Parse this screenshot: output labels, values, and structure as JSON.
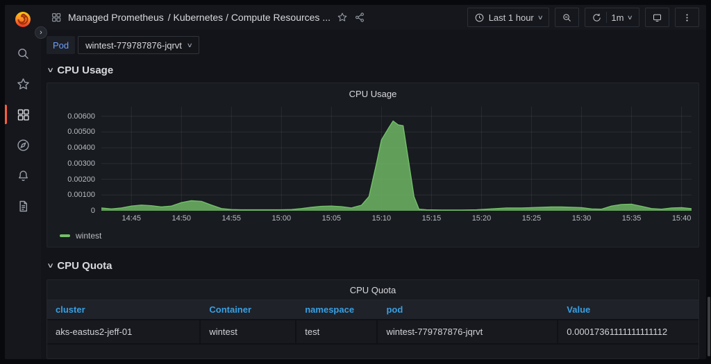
{
  "topnav": {
    "breadcrumb_root": "Managed Prometheus",
    "breadcrumb_path": "/ Kubernetes / Compute Resources ...",
    "time_range": "Last 1 hour",
    "refresh_interval": "1m"
  },
  "sidebar": {
    "icons": [
      "grafana-logo",
      "expand-sidebar",
      "search",
      "starred",
      "dashboards (active)",
      "explore",
      "alerting",
      "docs"
    ]
  },
  "filters": {
    "pod_label": "Pod",
    "pod_value": "wintest-779787876-jqrvt"
  },
  "sections": {
    "cpu_usage": "CPU Usage",
    "cpu_quota": "CPU Quota"
  },
  "chart_data": {
    "type": "area",
    "title": "CPU Usage",
    "xlabel": "",
    "ylabel": "",
    "grid": true,
    "legend_position": "bottom-left",
    "x_range": [
      "14:42:00",
      "15:41:00"
    ],
    "ylim": [
      0,
      0.0066
    ],
    "x_ticks": [
      "14:45",
      "14:50",
      "14:55",
      "15:00",
      "15:05",
      "15:10",
      "15:15",
      "15:20",
      "15:25",
      "15:30",
      "15:35",
      "15:40"
    ],
    "y_ticks": [
      {
        "v": 0,
        "label": "0"
      },
      {
        "v": 0.001,
        "label": "0.00100"
      },
      {
        "v": 0.002,
        "label": "0.00200"
      },
      {
        "v": 0.003,
        "label": "0.00300"
      },
      {
        "v": 0.004,
        "label": "0.00400"
      },
      {
        "v": 0.005,
        "label": "0.00500"
      },
      {
        "v": 0.006,
        "label": "0.00600"
      }
    ],
    "series": [
      {
        "name": "wintest",
        "color": "#73BF69",
        "points": [
          [
            "14:42:00",
            0.00018
          ],
          [
            "14:43:00",
            0.00012
          ],
          [
            "14:44:00",
            0.00018
          ],
          [
            "14:45:00",
            0.0003
          ],
          [
            "14:46:00",
            0.00036
          ],
          [
            "14:47:00",
            0.00032
          ],
          [
            "14:48:00",
            0.00024
          ],
          [
            "14:49:00",
            0.0003
          ],
          [
            "14:50:00",
            0.00052
          ],
          [
            "14:51:00",
            0.00064
          ],
          [
            "14:52:00",
            0.0006
          ],
          [
            "14:53:00",
            0.00036
          ],
          [
            "14:54:00",
            0.00014
          ],
          [
            "14:55:00",
            8e-05
          ],
          [
            "14:56:00",
            6e-05
          ],
          [
            "14:58:00",
            6e-05
          ],
          [
            "15:00:00",
            6e-05
          ],
          [
            "15:01:00",
            8e-05
          ],
          [
            "15:02:00",
            0.00014
          ],
          [
            "15:03:00",
            0.00022
          ],
          [
            "15:04:00",
            0.00028
          ],
          [
            "15:05:00",
            0.0003
          ],
          [
            "15:06:00",
            0.00026
          ],
          [
            "15:07:00",
            0.00018
          ],
          [
            "15:08:00",
            0.00035
          ],
          [
            "15:08:45",
            0.0009
          ],
          [
            "15:09:30",
            0.003
          ],
          [
            "15:10:00",
            0.0045
          ],
          [
            "15:10:40",
            0.0052
          ],
          [
            "15:11:10",
            0.0057
          ],
          [
            "15:11:40",
            0.00545
          ],
          [
            "15:12:10",
            0.0054
          ],
          [
            "15:12:45",
            0.003
          ],
          [
            "15:13:15",
            0.0009
          ],
          [
            "15:13:45",
            0.0001
          ],
          [
            "15:14:30",
            6e-05
          ],
          [
            "15:16:00",
            5e-05
          ],
          [
            "15:18:00",
            5e-05
          ],
          [
            "15:19:30",
            6e-05
          ],
          [
            "15:20:30",
            0.0001
          ],
          [
            "15:21:30",
            0.00014
          ],
          [
            "15:22:30",
            0.00018
          ],
          [
            "15:24:00",
            0.00018
          ],
          [
            "15:25:00",
            0.0002
          ],
          [
            "15:26:00",
            0.00022
          ],
          [
            "15:27:00",
            0.00024
          ],
          [
            "15:28:00",
            0.00024
          ],
          [
            "15:29:00",
            0.00022
          ],
          [
            "15:30:00",
            0.0002
          ],
          [
            "15:31:00",
            0.00012
          ],
          [
            "15:32:00",
            0.0001
          ],
          [
            "15:33:00",
            0.0003
          ],
          [
            "15:34:00",
            0.0004
          ],
          [
            "15:35:00",
            0.00042
          ],
          [
            "15:36:00",
            0.00028
          ],
          [
            "15:37:00",
            0.00014
          ],
          [
            "15:38:00",
            0.0001
          ],
          [
            "15:39:00",
            0.00018
          ],
          [
            "15:40:00",
            0.0002
          ],
          [
            "15:41:00",
            0.00013
          ]
        ]
      }
    ]
  },
  "table": {
    "title": "CPU Quota",
    "columns": [
      "cluster",
      "Container",
      "namespace",
      "pod",
      "Value"
    ],
    "rows": [
      [
        "aks-eastus2-jeff-01",
        "wintest",
        "test",
        "wintest-779787876-jqrvt",
        "0.00017361111111111112"
      ]
    ]
  },
  "colors": {
    "series_green": "#73BF69",
    "link_blue": "#6E9FFF",
    "table_header_blue": "#38A0E4",
    "active_orange": "#F55F3E",
    "panel_bg": "#181B20",
    "page_bg": "#121419"
  }
}
